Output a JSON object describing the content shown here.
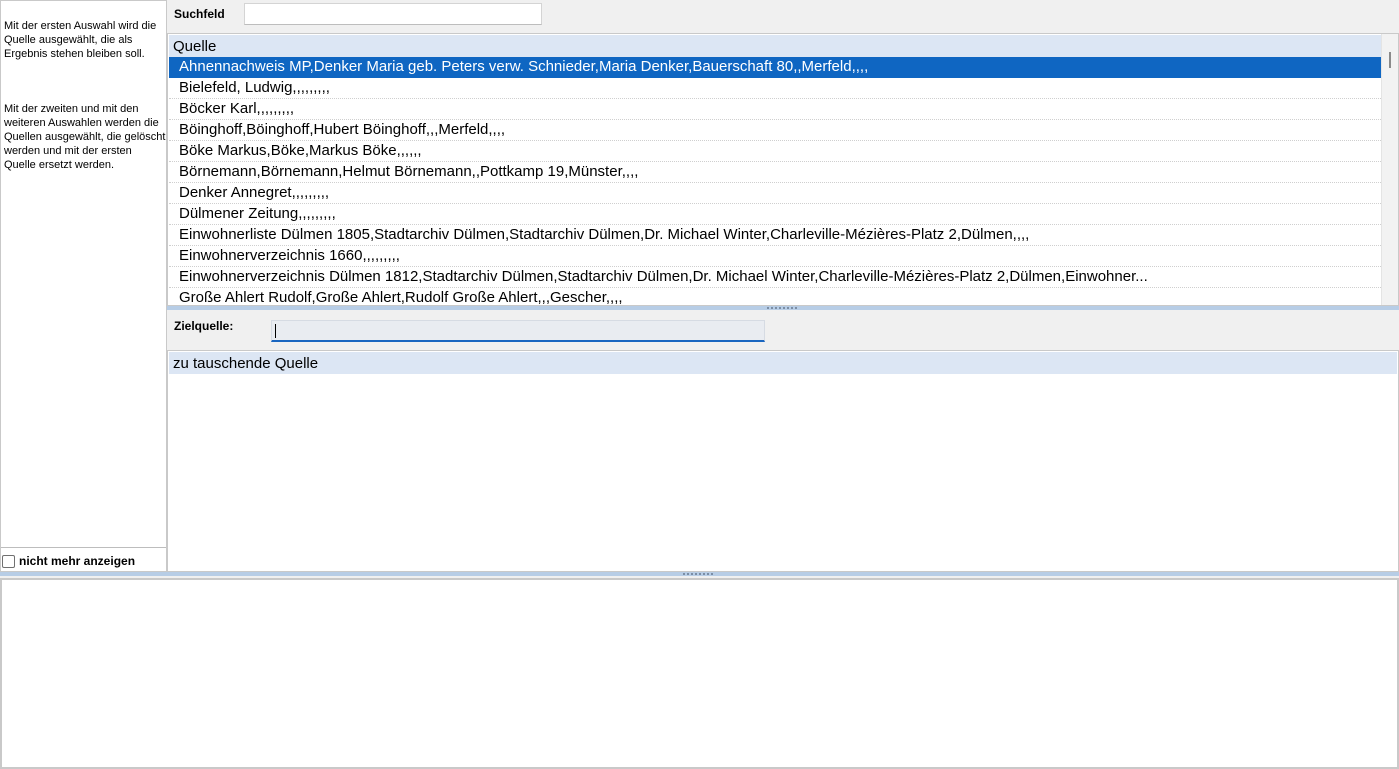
{
  "help": {
    "text_1": "Mit der ersten Auswahl wird die Quelle ausgewählt, die als Ergebnis stehen bleiben soll.",
    "text_2": "Mit der zweiten und mit den weiteren Auswahlen werden die Quellen ausgewählt, die gelöscht werden und mit der ersten Quelle ersetzt werden.",
    "dont_show_label": "nicht mehr anzeigen"
  },
  "search": {
    "label": "Suchfeld",
    "value": ""
  },
  "source_list": {
    "header": "Quelle",
    "selected_index": 0,
    "rows": [
      "Ahnennachweis MP,Denker Maria geb. Peters verw. Schnieder,Maria Denker,Bauerschaft 80,,Merfeld,,,,",
      "Bielefeld, Ludwig,,,,,,,,,",
      "Böcker Karl,,,,,,,,,",
      "Böinghoff,Böinghoff,Hubert Böinghoff,,,Merfeld,,,,",
      "Böke Markus,Böke,Markus Böke,,,,,,",
      "Börnemann,Börnemann,Helmut Börnemann,,Pottkamp 19,Münster,,,,",
      "Denker Annegret,,,,,,,,,",
      "Dülmener Zeitung,,,,,,,,,",
      "Einwohnerliste Dülmen 1805,Stadtarchiv Dülmen,Stadtarchiv Dülmen,Dr. Michael Winter,Charleville-Mézières-Platz 2,Dülmen,,,,",
      "Einwohnerverzeichnis 1660,,,,,,,,,",
      "Einwohnerverzeichnis Dülmen 1812,Stadtarchiv Dülmen,Stadtarchiv Dülmen,Dr. Michael Winter,Charleville-Mézières-Platz 2,Dülmen,Einwohner...",
      "Große Ahlert Rudolf,Große Ahlert,Rudolf Große Ahlert,,,Gescher,,,,"
    ]
  },
  "target": {
    "label": "Zielquelle:",
    "value": ""
  },
  "swap_list": {
    "header": "zu tauschende Quelle"
  },
  "colors": {
    "selection": "#0f66c2",
    "header_bg": "#dce6f4",
    "splitter": "#b7cde6",
    "focus_underline": "#1a66c0"
  }
}
